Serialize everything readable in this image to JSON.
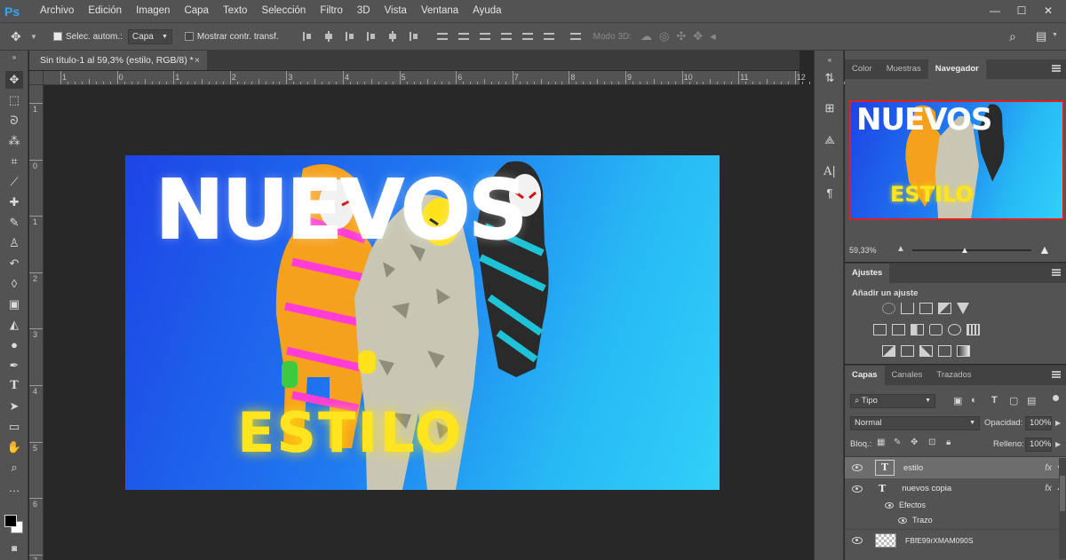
{
  "app": {
    "logo": "Ps"
  },
  "menu": [
    "Archivo",
    "Edición",
    "Imagen",
    "Capa",
    "Texto",
    "Selección",
    "Filtro",
    "3D",
    "Vista",
    "Ventana",
    "Ayuda"
  ],
  "window_controls": {
    "minimize": "—",
    "maximize": "☐",
    "close": "✕"
  },
  "options": {
    "auto_select_label": "Selec. autom.:",
    "auto_select_value": "Capa",
    "show_transform_label": "Mostrar contr. transf.",
    "mode_3d_label": "Modo 3D:"
  },
  "document": {
    "tab_title": "Sin título-1 al 59,3% (estilo, RGB/8) *",
    "close_glyph": "×",
    "ruler_top": [
      "1",
      "0",
      "1",
      "2",
      "3",
      "4",
      "5",
      "6",
      "7",
      "8",
      "9",
      "10",
      "11",
      "12"
    ],
    "ruler_left": [
      "1",
      "0",
      "1",
      "2",
      "3",
      "4",
      "5",
      "6",
      "7"
    ]
  },
  "artwork": {
    "title": "NUEVOS",
    "subtitle": "ESTILO"
  },
  "navigator": {
    "tabs": [
      "Color",
      "Muestras",
      "Navegador"
    ],
    "active_tab": "Navegador",
    "zoom": "59,33%",
    "preview_title": "NUEVOS",
    "preview_subtitle": "ESTILO"
  },
  "adjustments": {
    "title": "Ajustes",
    "subtitle": "Añadir un ajuste"
  },
  "layers_panel": {
    "tabs": [
      "Capas",
      "Canales",
      "Trazados"
    ],
    "active_tab": "Capas",
    "filter_label": "Tipo",
    "blend_mode": "Normal",
    "opacity_label": "Opacidad:",
    "opacity_value": "100%",
    "lock_label": "Bloq.:",
    "fill_label": "Relleno:",
    "fill_value": "100%",
    "layers": [
      {
        "name": "estilo",
        "type": "T",
        "fx": "fx",
        "selected": true
      },
      {
        "name": "nuevos copia",
        "type": "T",
        "fx": "fx",
        "selected": false
      }
    ],
    "effects_label": "Efectos",
    "stroke_label": "Trazo",
    "image_layer": "FBfE99rXMAM090S"
  },
  "colors": {
    "chrome": "#535353",
    "dark": "#282828",
    "accent_red": "#e02020",
    "title_white": "#ffffff",
    "subtitle_yellow": "#ffe51f"
  }
}
